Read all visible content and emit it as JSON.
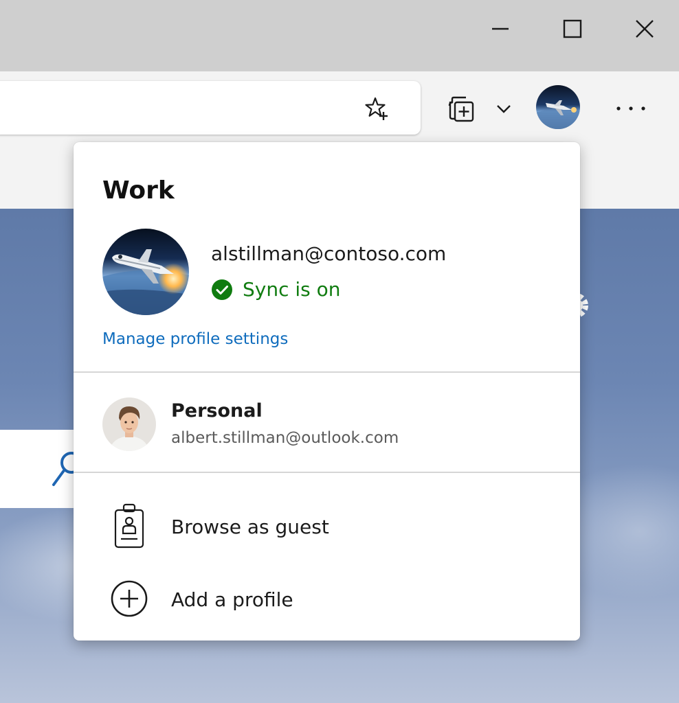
{
  "window": {
    "controls": {
      "minimize_icon": "minimize-icon",
      "maximize_icon": "maximize-icon",
      "close_icon": "close-icon"
    }
  },
  "toolbar": {
    "address_value": "",
    "icons": [
      "star-plus-icon",
      "collections-icon",
      "chevron-down-icon",
      "profile-avatar",
      "more-icon"
    ]
  },
  "flyout": {
    "title": "Work",
    "account": {
      "email": "alstillman@contoso.com",
      "sync_status": "Sync is on",
      "sync_color": "#107c10"
    },
    "manage_link": "Manage profile settings",
    "other_profiles": [
      {
        "name": "Personal",
        "email": "albert.stillman@outlook.com"
      }
    ],
    "actions": [
      {
        "label": "Browse as guest",
        "icon": "guest-badge-icon"
      },
      {
        "label": "Add a profile",
        "icon": "add-circle-icon"
      }
    ]
  },
  "colors": {
    "link": "#0f6cbd",
    "sync": "#107c10",
    "titlebar": "#cfcfcf",
    "toolbar": "#f3f3f3"
  }
}
